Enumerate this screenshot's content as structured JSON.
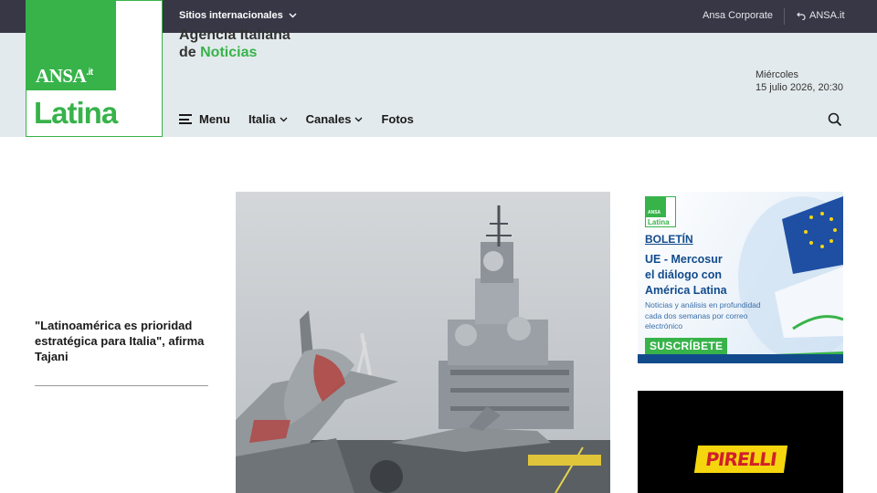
{
  "topbar": {
    "international_label": "Sitios internacionales",
    "corporate_label": "Ansa Corporate",
    "ansa_it_label": "ANSA.it"
  },
  "logo": {
    "ansa": "ANSA",
    "ansa_suffix": ".it",
    "latina": "Latina"
  },
  "agency": {
    "line1": "Agencia Italiana",
    "line2_prefix": "de",
    "line2_highlight": "Noticias"
  },
  "nav": {
    "menu": "Menu",
    "italia": "Italia",
    "canales": "Canales",
    "fotos": "Fotos"
  },
  "date": {
    "weekday": "Miércoles",
    "datetime": "15 julio 2026, 20:30"
  },
  "lead_story": {
    "title": "\"Latinoamérica es prioridad estratégica para Italia\", afirma Tajani"
  },
  "newsletter_ad": {
    "mini_logo_ansa": "ANSA",
    "mini_logo_latina": "Latina",
    "label": "BOLETÍN",
    "headline_line1": "UE - Mercosur",
    "headline_line2": "el diálogo con",
    "headline_line3": "América Latina",
    "description": "Noticias y análisis en profundidad cada dos semanas por correo electrónico",
    "cta": "SUSCRÍBETE"
  },
  "pirelli_ad": {
    "brand": "PIRELLI"
  },
  "colors": {
    "topbar": "#383746",
    "header": "#e3eaed",
    "brand_green": "#37b34a",
    "newsletter_blue": "#124b8c",
    "pirelli_yellow": "#f5d60e",
    "pirelli_red": "#d1202a"
  },
  "icons": {
    "dropdown": "chevron-down-icon",
    "external": "return-arrow-icon",
    "menu": "hamburger-icon",
    "search": "search-icon"
  }
}
